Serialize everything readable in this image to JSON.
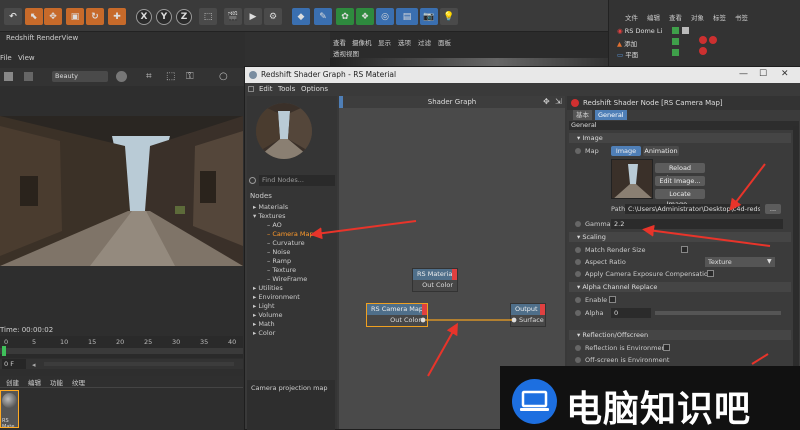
{
  "c4d": {
    "axis_buttons": [
      "X",
      "Y",
      "Z"
    ],
    "object_manager": {
      "menu": [
        "文件",
        "编辑",
        "查看",
        "对象",
        "标签",
        "书签"
      ],
      "objects": [
        "RS Dome Li",
        "添加",
        "平面"
      ]
    },
    "editor_tabs": [
      "透视视图"
    ],
    "editor_menu": [
      "查看",
      "摄像机",
      "显示",
      "选项",
      "过滤",
      "面板"
    ]
  },
  "renderview": {
    "title": "Redshift RenderView",
    "menu": [
      "File",
      "View"
    ],
    "aov_select": "Beauty",
    "time": "Time: 00:00:02",
    "timeline_ticks": [
      "0",
      "5",
      "10",
      "15",
      "20",
      "25",
      "30",
      "35",
      "40"
    ],
    "frame_field": "0 F",
    "material_tabs": [
      "创建",
      "编辑",
      "功能",
      "纹理"
    ],
    "material_label": "RS Mate"
  },
  "shader_window": {
    "title": "Redshift Shader Graph - RS Material",
    "menu": [
      "Edit",
      "Tools",
      "Options"
    ],
    "controls": [
      "—",
      "☐",
      "✕"
    ],
    "find_placeholder": "Find Nodes...",
    "nodes_label": "Nodes",
    "tree": [
      {
        "label": "Materials",
        "level": 0
      },
      {
        "label": "Textures",
        "level": 0
      },
      {
        "label": "AO",
        "level": 1
      },
      {
        "label": "Camera Map",
        "level": 1,
        "active": true
      },
      {
        "label": "Curvature",
        "level": 1
      },
      {
        "label": "Noise",
        "level": 1
      },
      {
        "label": "Ramp",
        "level": 1
      },
      {
        "label": "Texture",
        "level": 1
      },
      {
        "label": "WireFrame",
        "level": 1
      },
      {
        "label": "Utilities",
        "level": 0
      },
      {
        "label": "Environment",
        "level": 0
      },
      {
        "label": "Light",
        "level": 0
      },
      {
        "label": "Volume",
        "level": 0
      },
      {
        "label": "Math",
        "level": 0
      },
      {
        "label": "Color",
        "level": 0
      }
    ],
    "node_description": "Camera projection map",
    "graph_title": "Shader Graph",
    "nodes": {
      "rs_material": {
        "title": "RS Material",
        "port": "Out Color"
      },
      "rs_camera_map": {
        "title": "RS Camera Map",
        "port": "Out Color"
      },
      "output": {
        "title": "Output",
        "port": "Surface"
      }
    }
  },
  "attributes": {
    "title": "Redshift Shader Node [RS Camera Map]",
    "tabs": [
      "基本",
      "General"
    ],
    "group_label": "General",
    "image_section": "Image",
    "map_label": "Map",
    "map_tabs": [
      "Image",
      "Animation"
    ],
    "image_buttons": [
      "Reload Image...",
      "Edit Image...",
      "Locate Image..."
    ],
    "path_label": "Path",
    "path_value": "C:\\Users\\Administrator\\Desktop\\c4d-redsh",
    "path_browse": "...",
    "gamma_label": "Gamma",
    "gamma_value": "2.2",
    "scaling_section": "Scaling",
    "match_render_size": "Match Render Size",
    "aspect_ratio_label": "Aspect Ratio",
    "aspect_ratio_value": "Texture",
    "apply_exposure": "Apply Camera Exposure Compensation",
    "alpha_section": "Alpha Channel Replace",
    "enable_label": "Enable",
    "alpha_label": "Alpha",
    "alpha_value": "0",
    "reflection_section": "Reflection/Offscreen",
    "reflection_env": "Reflection is Environment",
    "offscreen_env": "Off-screen is Environment"
  },
  "watermark": {
    "text": "电脑知识吧"
  },
  "colors": {
    "accent_orange": "#ff9a2b",
    "arrow_red": "#e8342a",
    "selected_blue": "#4f7fb7",
    "watermark_blue": "#1d6fe0"
  }
}
